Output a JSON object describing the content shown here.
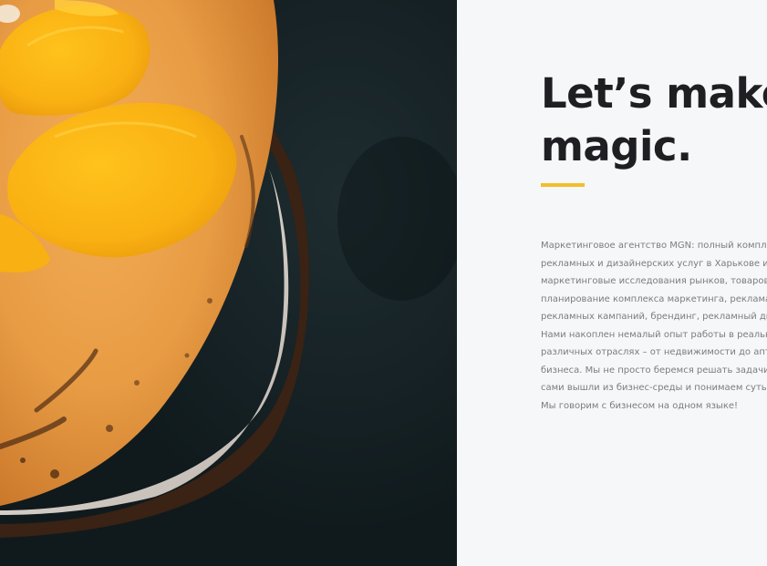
{
  "hero": {
    "headline_line1": "Let’s make",
    "headline_line2": "magic.",
    "accent_color": "#f2be2a",
    "description_lines": [
      "Маркетинговое агентство MGN: полный компл",
      "рекламных и дизайнерских услуг в Харькове и У",
      "маркетинговые исследования рынков, товарове",
      "планирование комплекса маркетинга, реклама,",
      "рекламных кампаний, брендинг, рекламный ди",
      "Нами накоплен немалый опыт работы в реальн",
      "различных отраслях – от недвижимости до апте",
      "бизнеса. Мы не просто беремся решать задачи",
      "сами вышли из бизнес-среды и понимаем суть",
      "Мы говорим с бизнесом на одном языке!"
    ]
  },
  "photo": {
    "subject": "fruit-photo",
    "background_color": "#152125"
  }
}
